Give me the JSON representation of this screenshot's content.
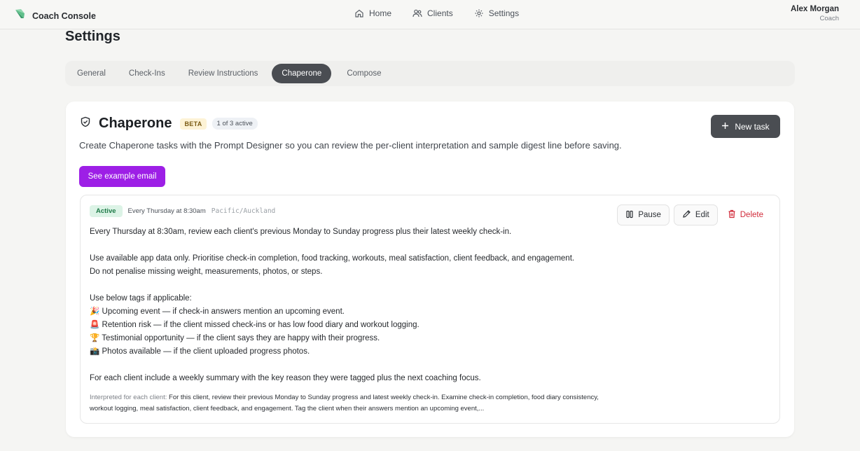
{
  "app": {
    "name": "Coach Console"
  },
  "nav": [
    {
      "label": "Home",
      "icon": "home-icon"
    },
    {
      "label": "Clients",
      "icon": "users-icon"
    },
    {
      "label": "Settings",
      "icon": "gear-icon"
    }
  ],
  "user": {
    "name": "Alex Morgan",
    "role": "Coach"
  },
  "page": {
    "title": "Settings"
  },
  "tabs": [
    {
      "label": "General"
    },
    {
      "label": "Check-Ins"
    },
    {
      "label": "Review Instructions"
    },
    {
      "label": "Chaperone",
      "active": true
    },
    {
      "label": "Compose"
    }
  ],
  "card": {
    "title": "Chaperone",
    "beta": "BETA",
    "active_count": "1 of 3 active",
    "new_task": "New task",
    "description": "Create Chaperone tasks with the Prompt Designer so you can review the per-client interpretation and sample digest line before saving.",
    "example_button": "See example email"
  },
  "task": {
    "status": "Active",
    "schedule": "Every Thursday at 8:30am",
    "timezone": "Pacific/Auckland",
    "actions": {
      "pause": "Pause",
      "edit": "Edit",
      "delete": "Delete"
    },
    "lines": [
      "Every Thursday at 8:30am, review each client's previous Monday to Sunday progress plus their latest weekly check-in.",
      "",
      "Use available app data only. Prioritise check-in completion, food tracking, workouts, meal satisfaction, client feedback, and engagement.",
      "Do not penalise missing weight, measurements, photos, or steps.",
      "",
      "Use below tags if applicable:",
      "🎉 Upcoming event — if check-in answers mention an upcoming event.",
      "🚨 Retention risk — if the client missed check-ins or has low food diary and workout logging.",
      "🏆 Testimonial opportunity — if the client says they are happy with their progress.",
      "📸 Photos available — if the client uploaded progress photos.",
      "",
      "For each client include a weekly summary with the key reason they were tagged plus the next coaching focus."
    ],
    "interpreted_label": "Interpreted for each client:",
    "interpreted_text": "For this client, review their previous Monday to Sunday progress and latest weekly check-in. Examine check-in completion, food diary consistency, workout logging, meal satisfaction, client feedback, and engagement. Tag the client when their answers mention an upcoming event,..."
  },
  "colors": {
    "accent_purple": "#9d1fe6",
    "dark_button": "#4a4d52",
    "active_green": "#1e7a48",
    "delete_red": "#d12b3a",
    "brand_green": "#3a9a6a"
  }
}
